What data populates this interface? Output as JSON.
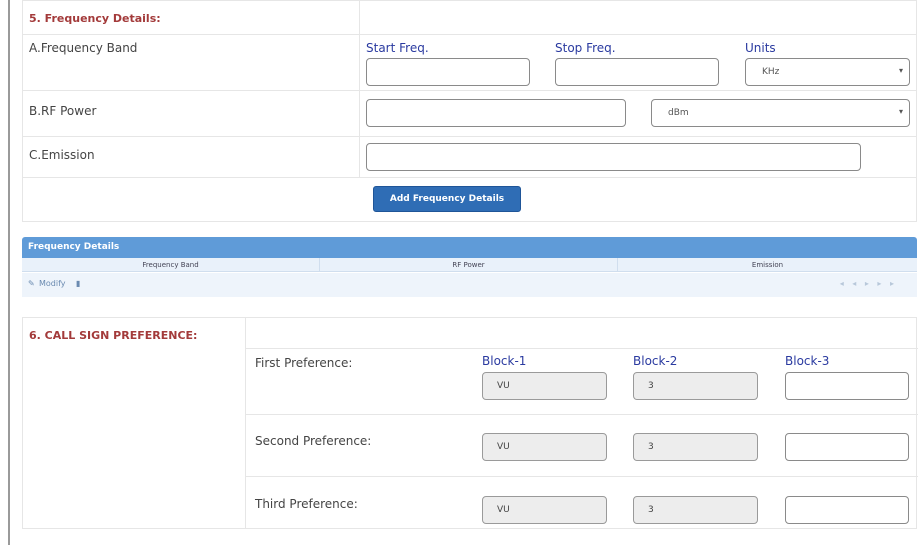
{
  "section5": {
    "title": "5. Frequency Details:",
    "rows": {
      "band": {
        "label": "A.Frequency Band",
        "start_header": "Start Freq.",
        "stop_header": "Stop Freq.",
        "units_header": "Units",
        "start_value": "",
        "stop_value": "",
        "units_value": "KHz"
      },
      "power": {
        "label": "B.RF Power",
        "value": "",
        "unit_value": "dBm"
      },
      "emission": {
        "label": "C.Emission",
        "value": ""
      }
    },
    "add_button": "Add Frequency Details"
  },
  "grid": {
    "caption": "Frequency Details",
    "columns": [
      "Frequency Band",
      "RF Power",
      "Emission"
    ],
    "pager": {
      "modify_label": "Modify"
    }
  },
  "section6": {
    "title": "6. CALL SIGN PREFERENCE:",
    "block_headers": [
      "Block-1",
      "Block-2",
      "Block-3"
    ],
    "preferences": [
      {
        "label": "First Preference:",
        "block1": "VU",
        "block2": "3",
        "block3": ""
      },
      {
        "label": "Second Preference:",
        "block1": "VU",
        "block2": "3",
        "block3": ""
      },
      {
        "label": "Third Preference:",
        "block1": "VU",
        "block2": "3",
        "block3": ""
      }
    ]
  },
  "icons": {
    "dropdown": "chevron-down-icon",
    "edit": "pencil-icon",
    "delete": "trash-icon"
  },
  "colors": {
    "section_title": "#a33a3a",
    "column_header": "#2a3aa0",
    "button": "#2f6db5",
    "grid_caption": "#5f9bd8"
  }
}
